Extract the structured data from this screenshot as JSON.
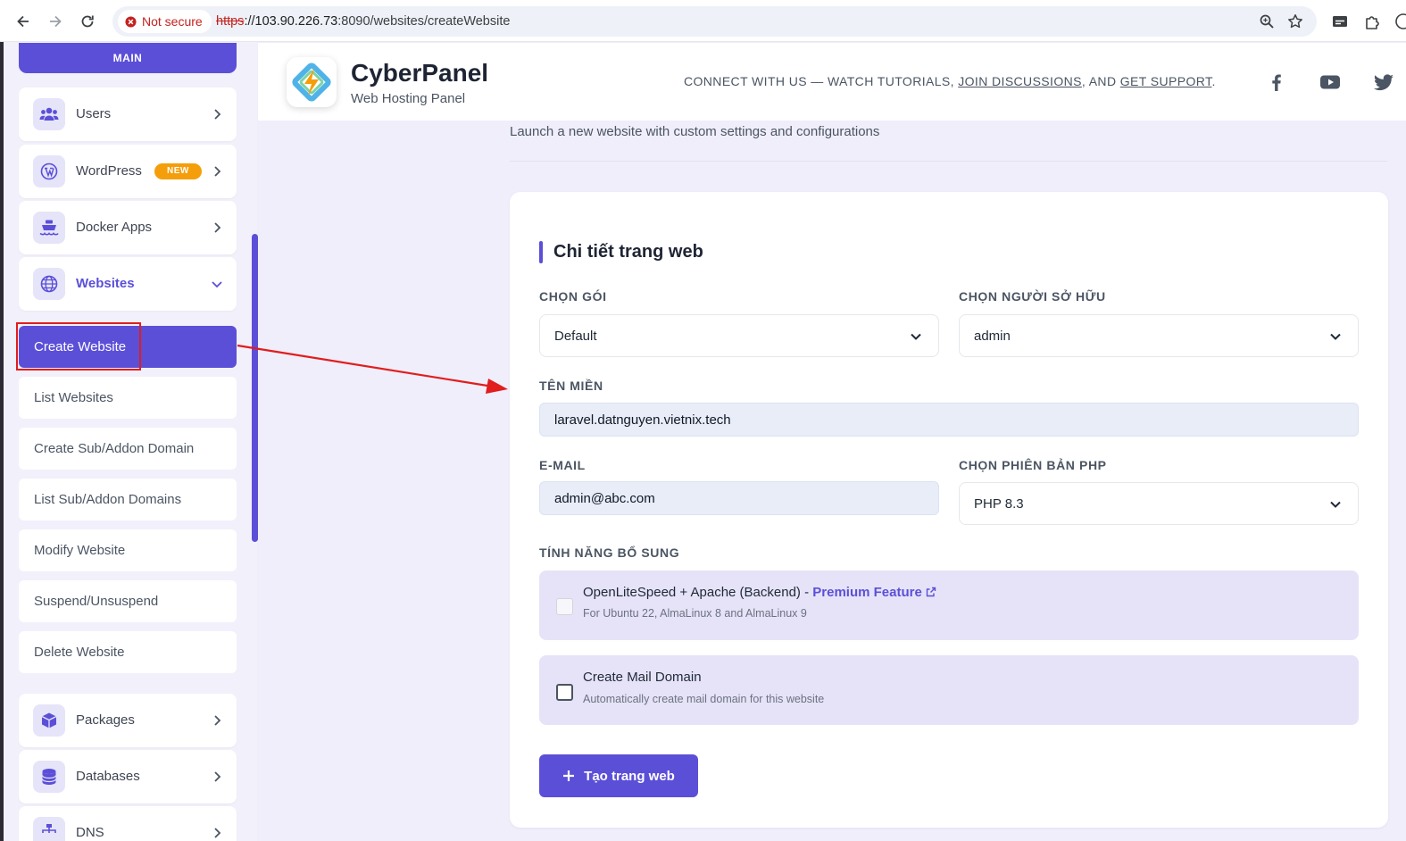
{
  "browser": {
    "security_label": "Not secure",
    "url_protocol": "https",
    "url_host": "://103.90.226.73",
    "url_rest": ":8090/websites/createWebsite"
  },
  "sidebar": {
    "main_label": "MAIN",
    "nav_items": [
      {
        "label": "Users",
        "icon": "users-icon"
      },
      {
        "label": "WordPress",
        "icon": "wordpress-icon",
        "badge": "NEW"
      },
      {
        "label": "Docker Apps",
        "icon": "docker-icon"
      },
      {
        "label": "Websites",
        "icon": "globe-icon",
        "expanded": true
      }
    ],
    "sub_items": [
      {
        "label": "Create Website",
        "active": true
      },
      {
        "label": "List Websites"
      },
      {
        "label": "Create Sub/Addon Domain"
      },
      {
        "label": "List Sub/Addon Domains"
      },
      {
        "label": "Modify Website"
      },
      {
        "label": "Suspend/Unsuspend"
      },
      {
        "label": "Delete Website"
      }
    ],
    "nav_items_after": [
      {
        "label": "Packages",
        "icon": "package-icon"
      },
      {
        "label": "Databases",
        "icon": "database-icon"
      },
      {
        "label": "DNS",
        "icon": "dns-icon"
      }
    ]
  },
  "header": {
    "brand": "CyberPanel",
    "brand_sub": "Web Hosting Panel",
    "connect_prefix": "CONNECT WITH US — WATCH TUTORIALS, ",
    "connect_link1": "JOIN DISCUSSIONS",
    "connect_mid": ", AND ",
    "connect_link2": "GET SUPPORT",
    "connect_suffix": "."
  },
  "page": {
    "subtitle": "Launch a new website with custom settings and configurations"
  },
  "form": {
    "section_title": "Chi tiết trang web",
    "package_label": "CHỌN GÓI",
    "package_value": "Default",
    "owner_label": "CHỌN NGƯỜI SỞ HỮU",
    "owner_value": "admin",
    "domain_label": "TÊN MIỀN",
    "domain_value": "laravel.datnguyen.vietnix.tech",
    "email_label": "E-MAIL",
    "email_value": "admin@abc.com",
    "php_label": "CHỌN PHIÊN BẢN PHP",
    "php_value": "PHP 8.3",
    "features_label": "TÍNH NĂNG BỔ SUNG",
    "feature1_title": "OpenLiteSpeed + Apache (Backend) - ",
    "feature1_premium": "Premium Feature",
    "feature1_desc": "For Ubuntu 22, AlmaLinux 8 and AlmaLinux 9",
    "feature1_checked": false,
    "feature2_title": "Create Mail Domain",
    "feature2_desc": "Automatically create mail domain for this website",
    "feature2_checked": false,
    "submit_label": "Tạo trang web"
  },
  "colors": {
    "accent": "#5b4fd8",
    "badge": "#f59e0b",
    "annotation": "#e11d1d"
  }
}
